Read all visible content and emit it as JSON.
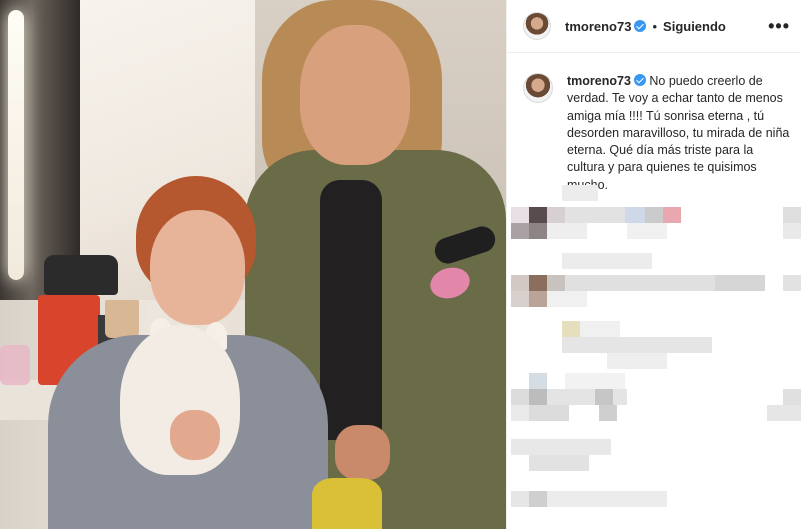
{
  "post": {
    "username": "tmoreno73",
    "follow_status": "Siguiendo",
    "separator": "•",
    "more_label": "•••",
    "caption": "No puedo creerlo de verdad. Te voy a echar tanto de menos amiga mía !!!! Tú sonrisa eterna , tú desorden maravilloso, tu mirada de niña eterna. Qué día más triste para la cultura y para quienes te quisimos mucho."
  },
  "colors": {
    "verified_badge": "#3897f0",
    "text": "#262626",
    "divider": "#efefef"
  },
  "icons": {
    "verified": "verified-badge-icon",
    "more": "more-options-icon"
  }
}
